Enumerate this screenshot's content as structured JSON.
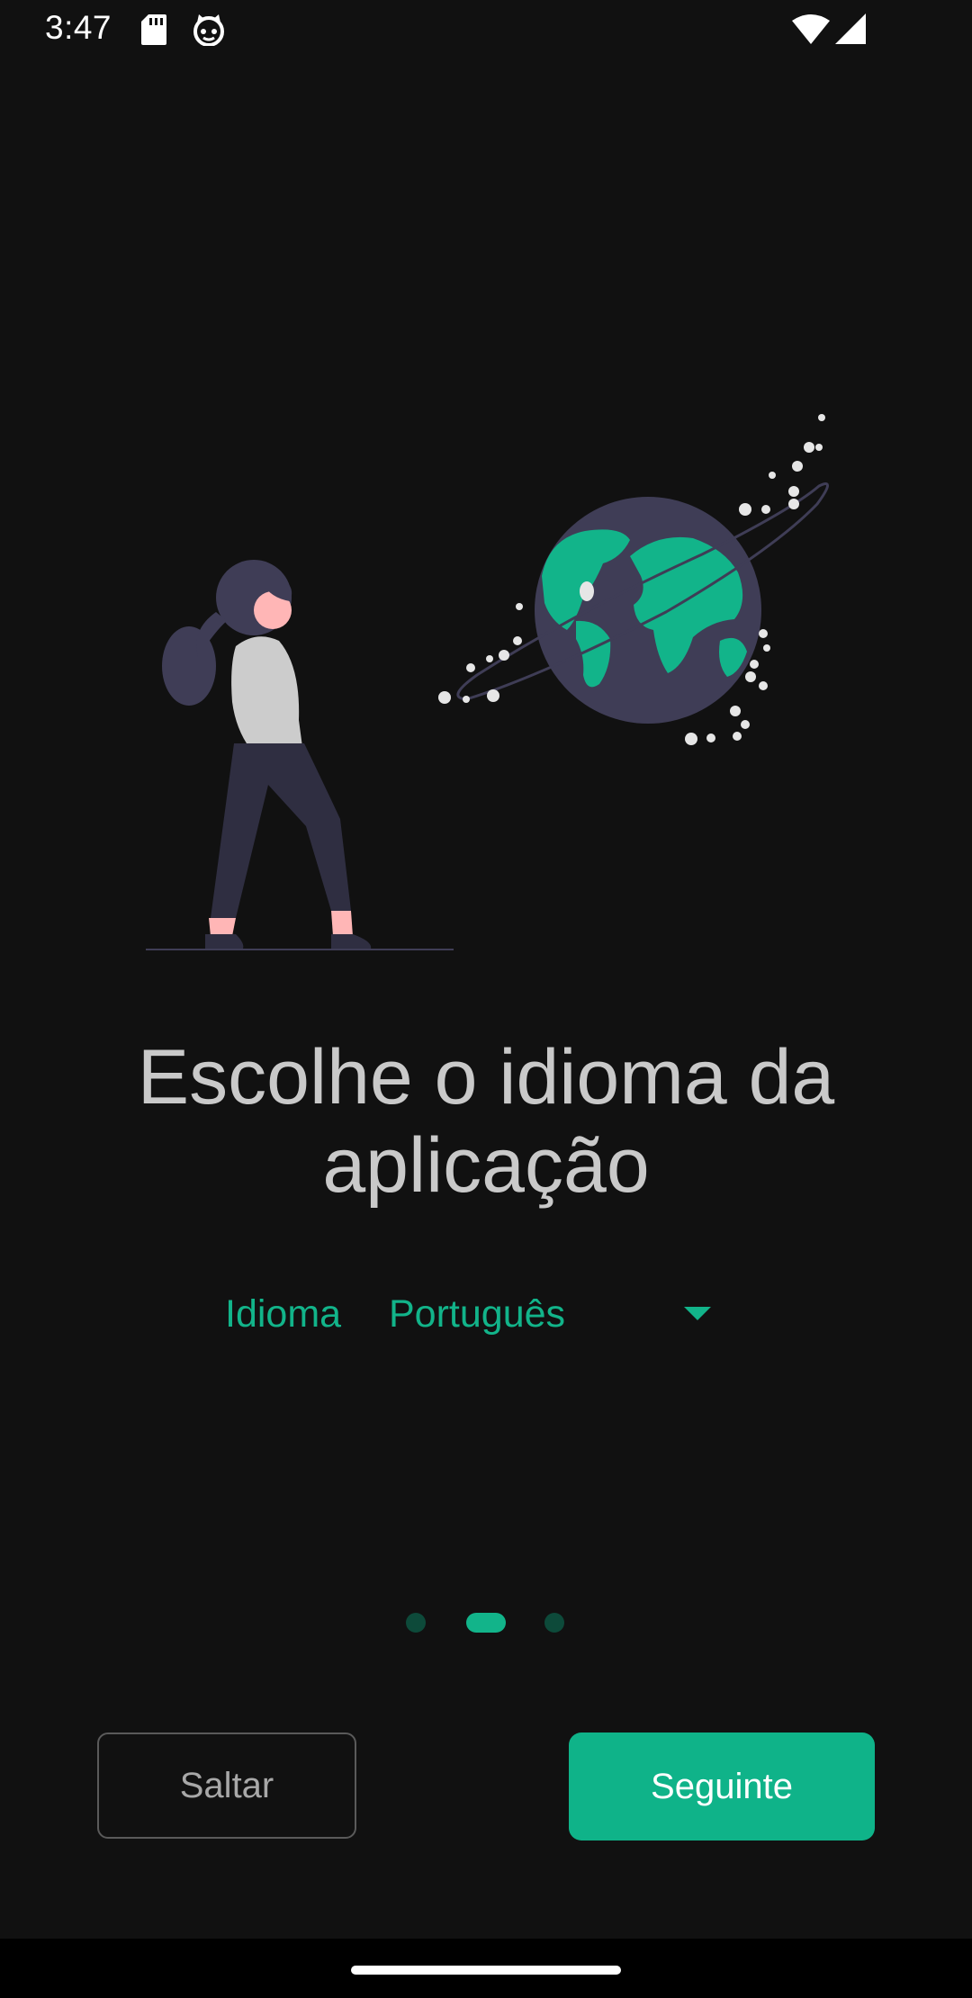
{
  "status_bar": {
    "time": "3:47",
    "left_icons": [
      "sd-card-icon",
      "cat-face-icon"
    ],
    "right_icons": [
      "wifi-icon",
      "signal-icon"
    ]
  },
  "illustration": {
    "subject": "woman-looking-at-globe",
    "colors": {
      "accent": "#12b48a",
      "globe": "#3f3d56",
      "shirt": "#cccccc",
      "skin": "#ffb6b6"
    }
  },
  "onboarding": {
    "title_line1": "Escolhe o idioma da",
    "title_line2": "aplicação",
    "language_label": "Idioma",
    "language_value": "Português",
    "page_indicator": {
      "count": 3,
      "active_index": 1
    }
  },
  "buttons": {
    "skip_label": "Saltar",
    "next_label": "Seguinte"
  },
  "colors": {
    "background": "#111111",
    "accent": "#12b48a",
    "button_primary": "#0fb389"
  }
}
